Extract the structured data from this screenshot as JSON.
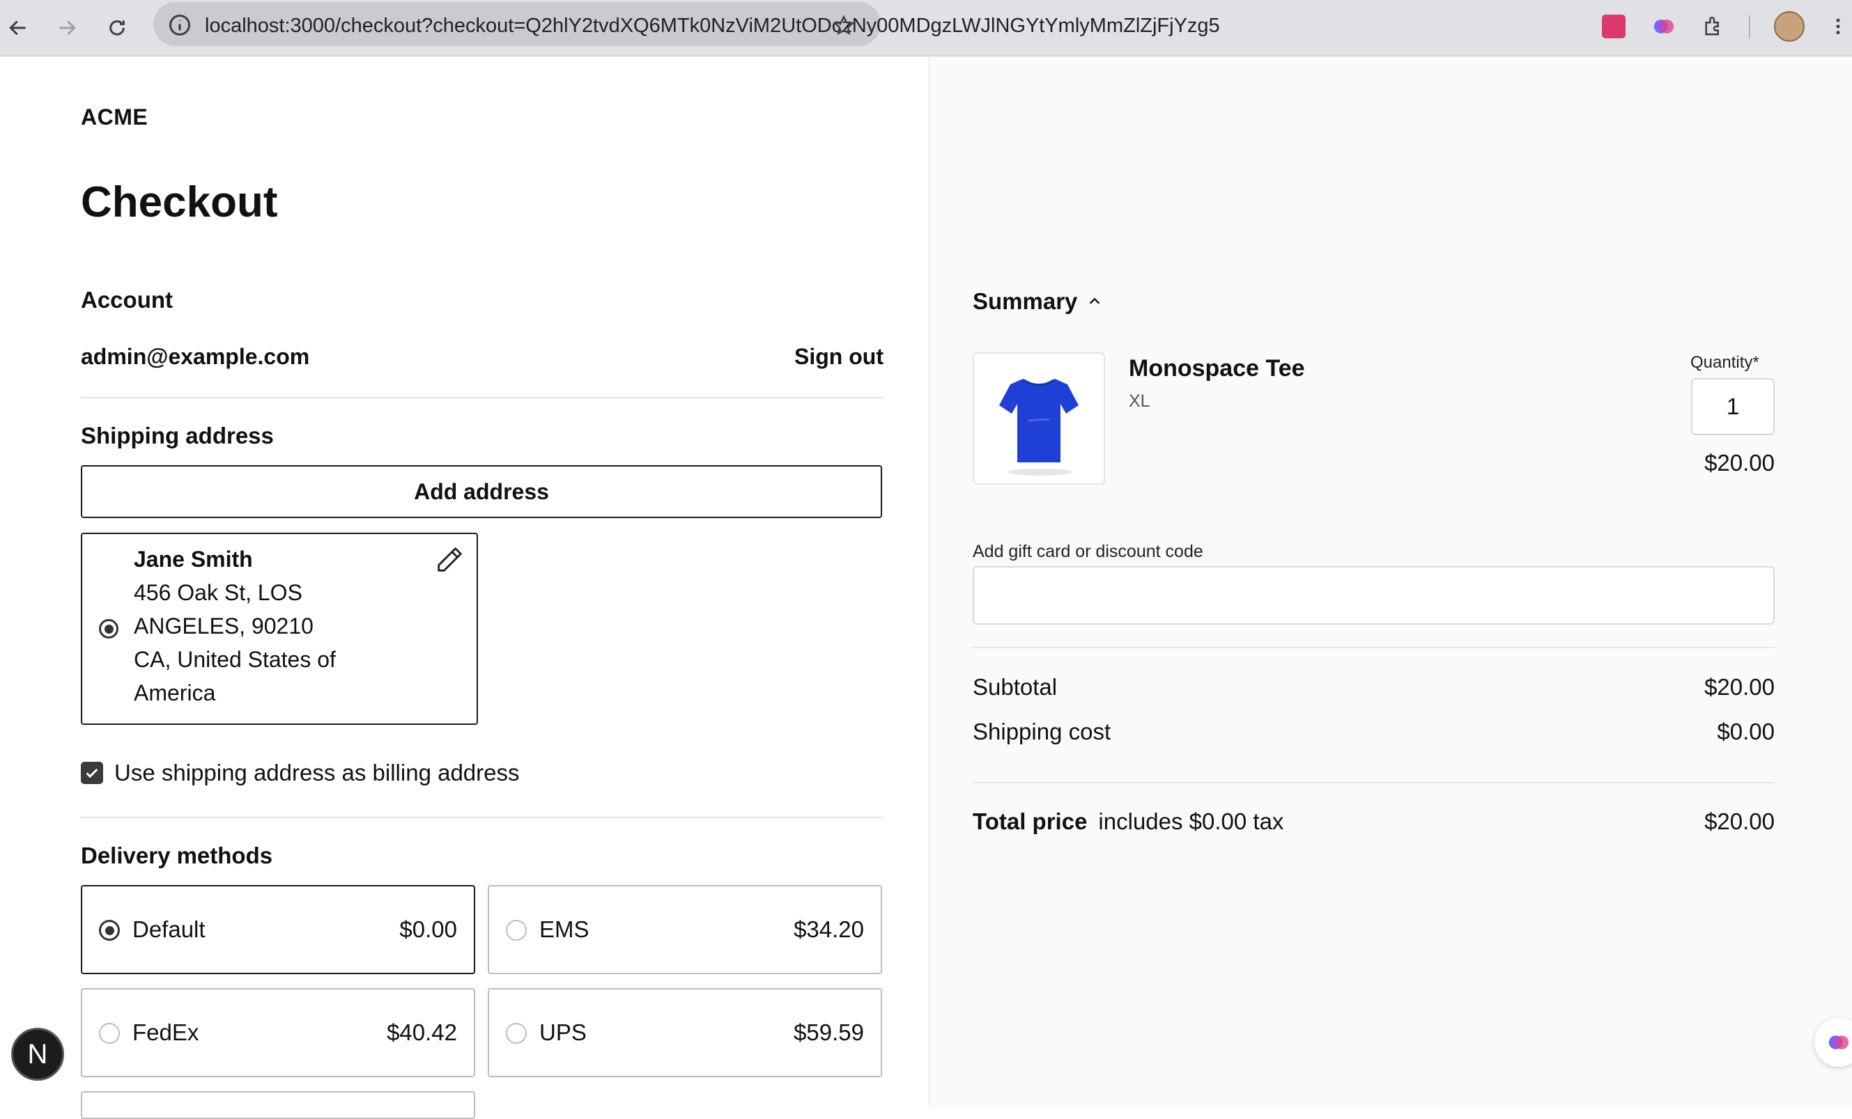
{
  "browser": {
    "url": "localhost:3000/checkout?checkout=Q2hlY2tvdXQ6MTk0NzViM2UtODczNy00MDgzLWJlNGYtYmlyMmZlZjFjYzg5"
  },
  "header": {
    "brand": "ACME",
    "title": "Checkout"
  },
  "account": {
    "heading": "Account",
    "email": "admin@example.com",
    "sign_out": "Sign out"
  },
  "shipping": {
    "heading": "Shipping address",
    "add_button": "Add address",
    "address": {
      "name": "Jane Smith",
      "line1": "456 Oak St, LOS",
      "line2": "ANGELES, 90210",
      "line3": "CA, United States of",
      "line4": "America",
      "selected": true
    },
    "billing_checkbox_label": "Use shipping address as billing address",
    "billing_checked": true
  },
  "delivery": {
    "heading": "Delivery methods",
    "methods": [
      {
        "name": "Default",
        "price": "$0.00",
        "selected": true
      },
      {
        "name": "EMS",
        "price": "$34.20",
        "selected": false
      },
      {
        "name": "FedEx",
        "price": "$40.42",
        "selected": false
      },
      {
        "name": "UPS",
        "price": "$59.59",
        "selected": false
      }
    ]
  },
  "dev_badge": "N",
  "summary": {
    "heading": "Summary",
    "item": {
      "name": "Monospace Tee",
      "variant": "XL",
      "quantity_label": "Quantity*",
      "quantity": "1",
      "price": "$20.00"
    },
    "gift_label": "Add gift card or discount code",
    "gift_value": "",
    "subtotal_label": "Subtotal",
    "subtotal": "$20.00",
    "shipping_label": "Shipping cost",
    "shipping": "$0.00",
    "total_label": "Total price",
    "total_tax_note": "includes $0.00 tax",
    "total": "$20.00"
  },
  "colors": {
    "accent": "#1a1a1a",
    "tee": "#1f3fd6"
  }
}
